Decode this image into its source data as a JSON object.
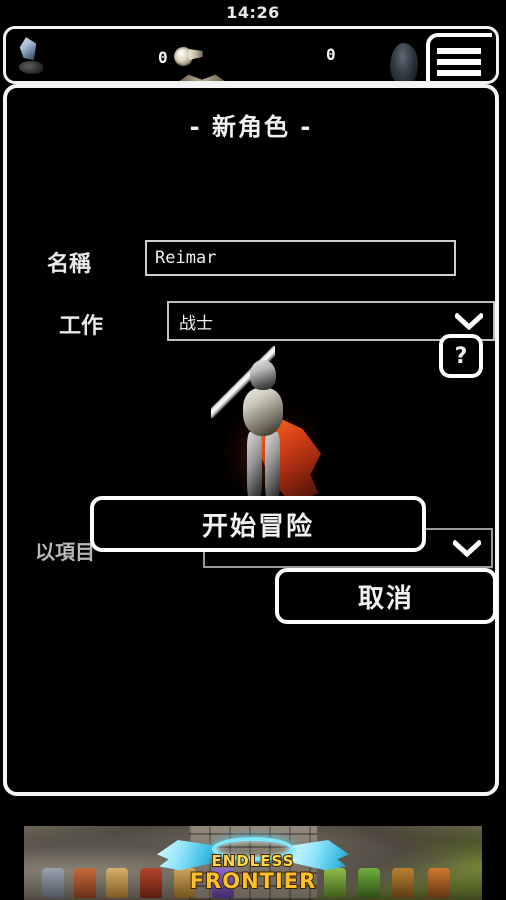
{
  "status_bar": {
    "time": "14:26"
  },
  "hud": {
    "gem_icon": "crystal-icon",
    "gem_value": "0",
    "coin_icon": "coin-icon",
    "coin_value": "0",
    "menu_icon": "hamburger-icon"
  },
  "dialog": {
    "title": "- 新角色 -",
    "name": {
      "label": "名稱",
      "value": "Reimar",
      "placeholder": ""
    },
    "job": {
      "label": "工作",
      "value": "战士",
      "chevron_icon": "chevron-down-icon"
    },
    "character": {
      "sprite_name": "warrior-knight-sprite"
    },
    "help": {
      "label": "?"
    },
    "item": {
      "label": "以項目",
      "value": "",
      "chevron_icon": "chevron-down-icon"
    },
    "start_button": "开始冒险",
    "cancel_button": "取消"
  },
  "banner_ad": {
    "title_line1": "ENDLESS",
    "title_line2": "FRONTIER"
  },
  "colors": {
    "background": "#000000",
    "border": "#ffffff",
    "text": "#f2f2f2",
    "cape": "#e8491a",
    "halo": "#7fe9ff",
    "logo": "#ffc02a"
  }
}
